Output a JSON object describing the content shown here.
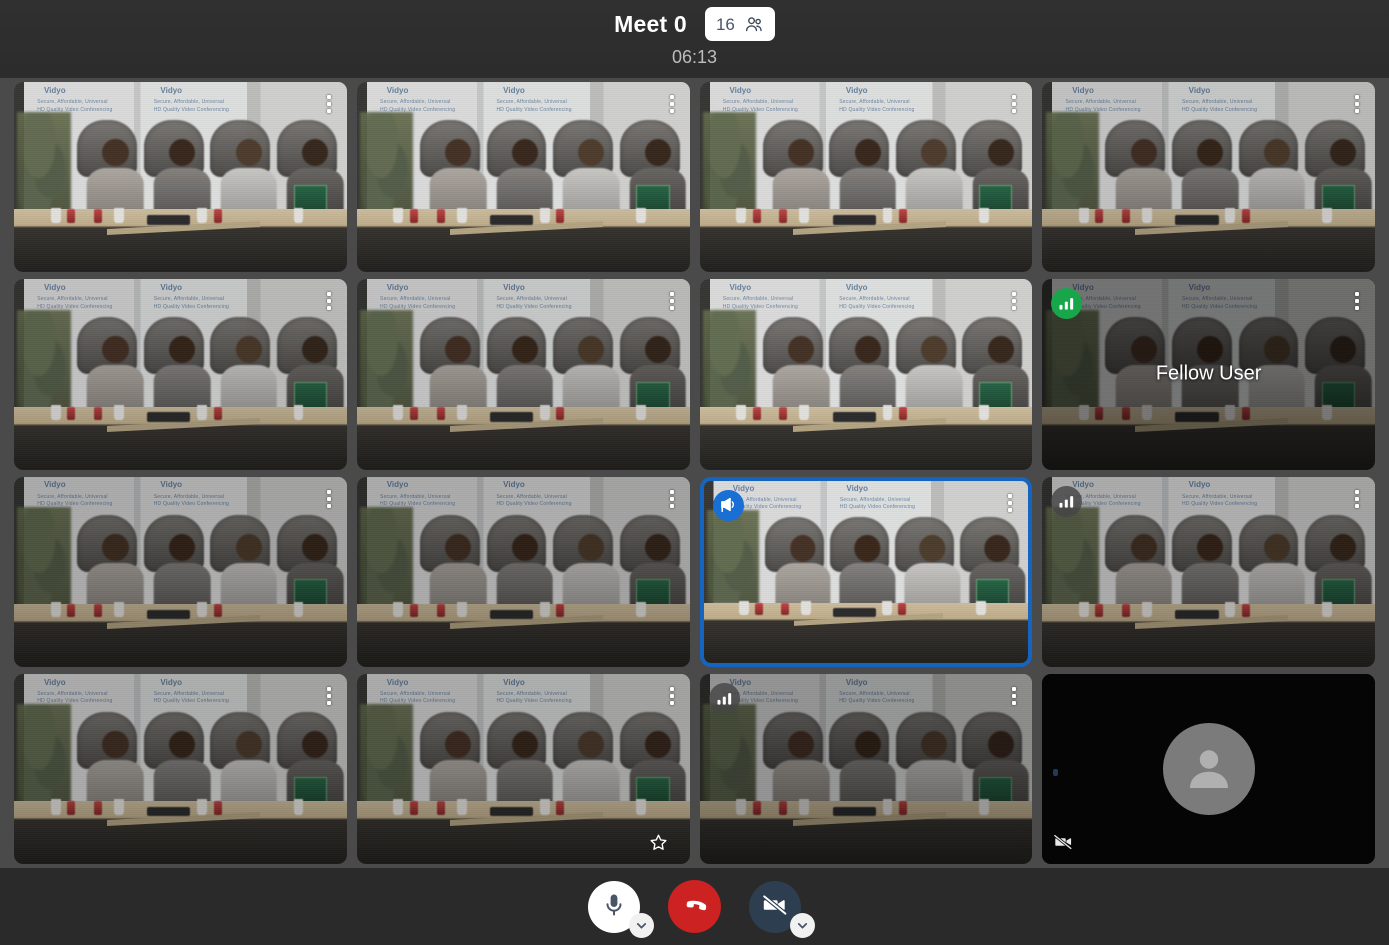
{
  "header": {
    "title": "Meet 0",
    "participant_count": "16",
    "people_icon": "people-group-icon",
    "timer": "06:13"
  },
  "grid": {
    "columns": 4,
    "rows": 4,
    "tiles": [
      {
        "id": "tile-1",
        "kind": "video",
        "tone": "tone-a",
        "badge": null,
        "name": null,
        "star": false,
        "camera_off": false
      },
      {
        "id": "tile-2",
        "kind": "video",
        "tone": "tone-a",
        "badge": null,
        "name": null,
        "star": false,
        "camera_off": false
      },
      {
        "id": "tile-3",
        "kind": "video",
        "tone": "tone-a",
        "badge": null,
        "name": null,
        "star": false,
        "camera_off": false
      },
      {
        "id": "tile-4",
        "kind": "video",
        "tone": "tone-b",
        "badge": null,
        "name": null,
        "star": false,
        "camera_off": false
      },
      {
        "id": "tile-5",
        "kind": "video",
        "tone": "tone-b",
        "badge": null,
        "name": null,
        "star": false,
        "camera_off": false
      },
      {
        "id": "tile-6",
        "kind": "video",
        "tone": "tone-b",
        "badge": null,
        "name": null,
        "star": false,
        "camera_off": false
      },
      {
        "id": "tile-7",
        "kind": "video",
        "tone": "tone-a",
        "badge": null,
        "name": null,
        "star": false,
        "camera_off": false
      },
      {
        "id": "tile-8",
        "kind": "video",
        "tone": "tone-e",
        "badge": "signal-green",
        "name": "Fellow User",
        "star": false,
        "camera_off": false
      },
      {
        "id": "tile-9",
        "kind": "video",
        "tone": "tone-c",
        "badge": null,
        "name": null,
        "star": false,
        "camera_off": false
      },
      {
        "id": "tile-10",
        "kind": "video",
        "tone": "tone-c",
        "badge": null,
        "name": null,
        "star": false,
        "camera_off": false
      },
      {
        "id": "tile-11",
        "kind": "video",
        "tone": "tone-a",
        "badge": "speaker-blue",
        "name": null,
        "star": false,
        "camera_off": false,
        "selected": true
      },
      {
        "id": "tile-12",
        "kind": "video",
        "tone": "tone-c",
        "badge": "signal-gray",
        "name": null,
        "star": false,
        "camera_off": false
      },
      {
        "id": "tile-13",
        "kind": "video",
        "tone": "tone-c",
        "badge": null,
        "name": null,
        "star": false,
        "camera_off": false
      },
      {
        "id": "tile-14",
        "kind": "video",
        "tone": "tone-c",
        "badge": null,
        "name": null,
        "star": true,
        "camera_off": false
      },
      {
        "id": "tile-15",
        "kind": "video",
        "tone": "tone-d",
        "badge": "signal-gray",
        "name": null,
        "star": false,
        "camera_off": false
      },
      {
        "id": "tile-16",
        "kind": "avatar",
        "tone": "",
        "badge": null,
        "name": null,
        "star": false,
        "camera_off": true
      }
    ],
    "video_banner": {
      "brand": "Vidyo",
      "line1": "Secure, Affordable, Universal",
      "line2": "HD Quality Video Conferencing"
    },
    "icons": {
      "kebab": "more-options-icon",
      "signal": "network-signal-icon",
      "speaker": "dominant-speaker-icon",
      "star": "pin-star-icon",
      "camera_off": "camera-off-icon",
      "avatar": "person-avatar-icon"
    }
  },
  "controls": {
    "mic": {
      "label": "Microphone",
      "icon": "microphone-icon",
      "state": "on"
    },
    "mic_options": {
      "label": "Audio settings",
      "icon": "chevron-down-icon"
    },
    "hangup": {
      "label": "Leave call",
      "icon": "hangup-phone-icon"
    },
    "camera": {
      "label": "Camera",
      "icon": "camera-off-icon",
      "state": "off"
    },
    "camera_options": {
      "label": "Video settings",
      "icon": "chevron-down-icon"
    }
  },
  "colors": {
    "accent_blue": "#1565c0",
    "speaker_blue": "#1a6fd4",
    "signal_green": "#18a64a",
    "hangup_red": "#cc2222",
    "camera_navy": "#2c3e50",
    "page_bg": "#2a2a2a",
    "grid_bg": "#4a4a4a"
  }
}
